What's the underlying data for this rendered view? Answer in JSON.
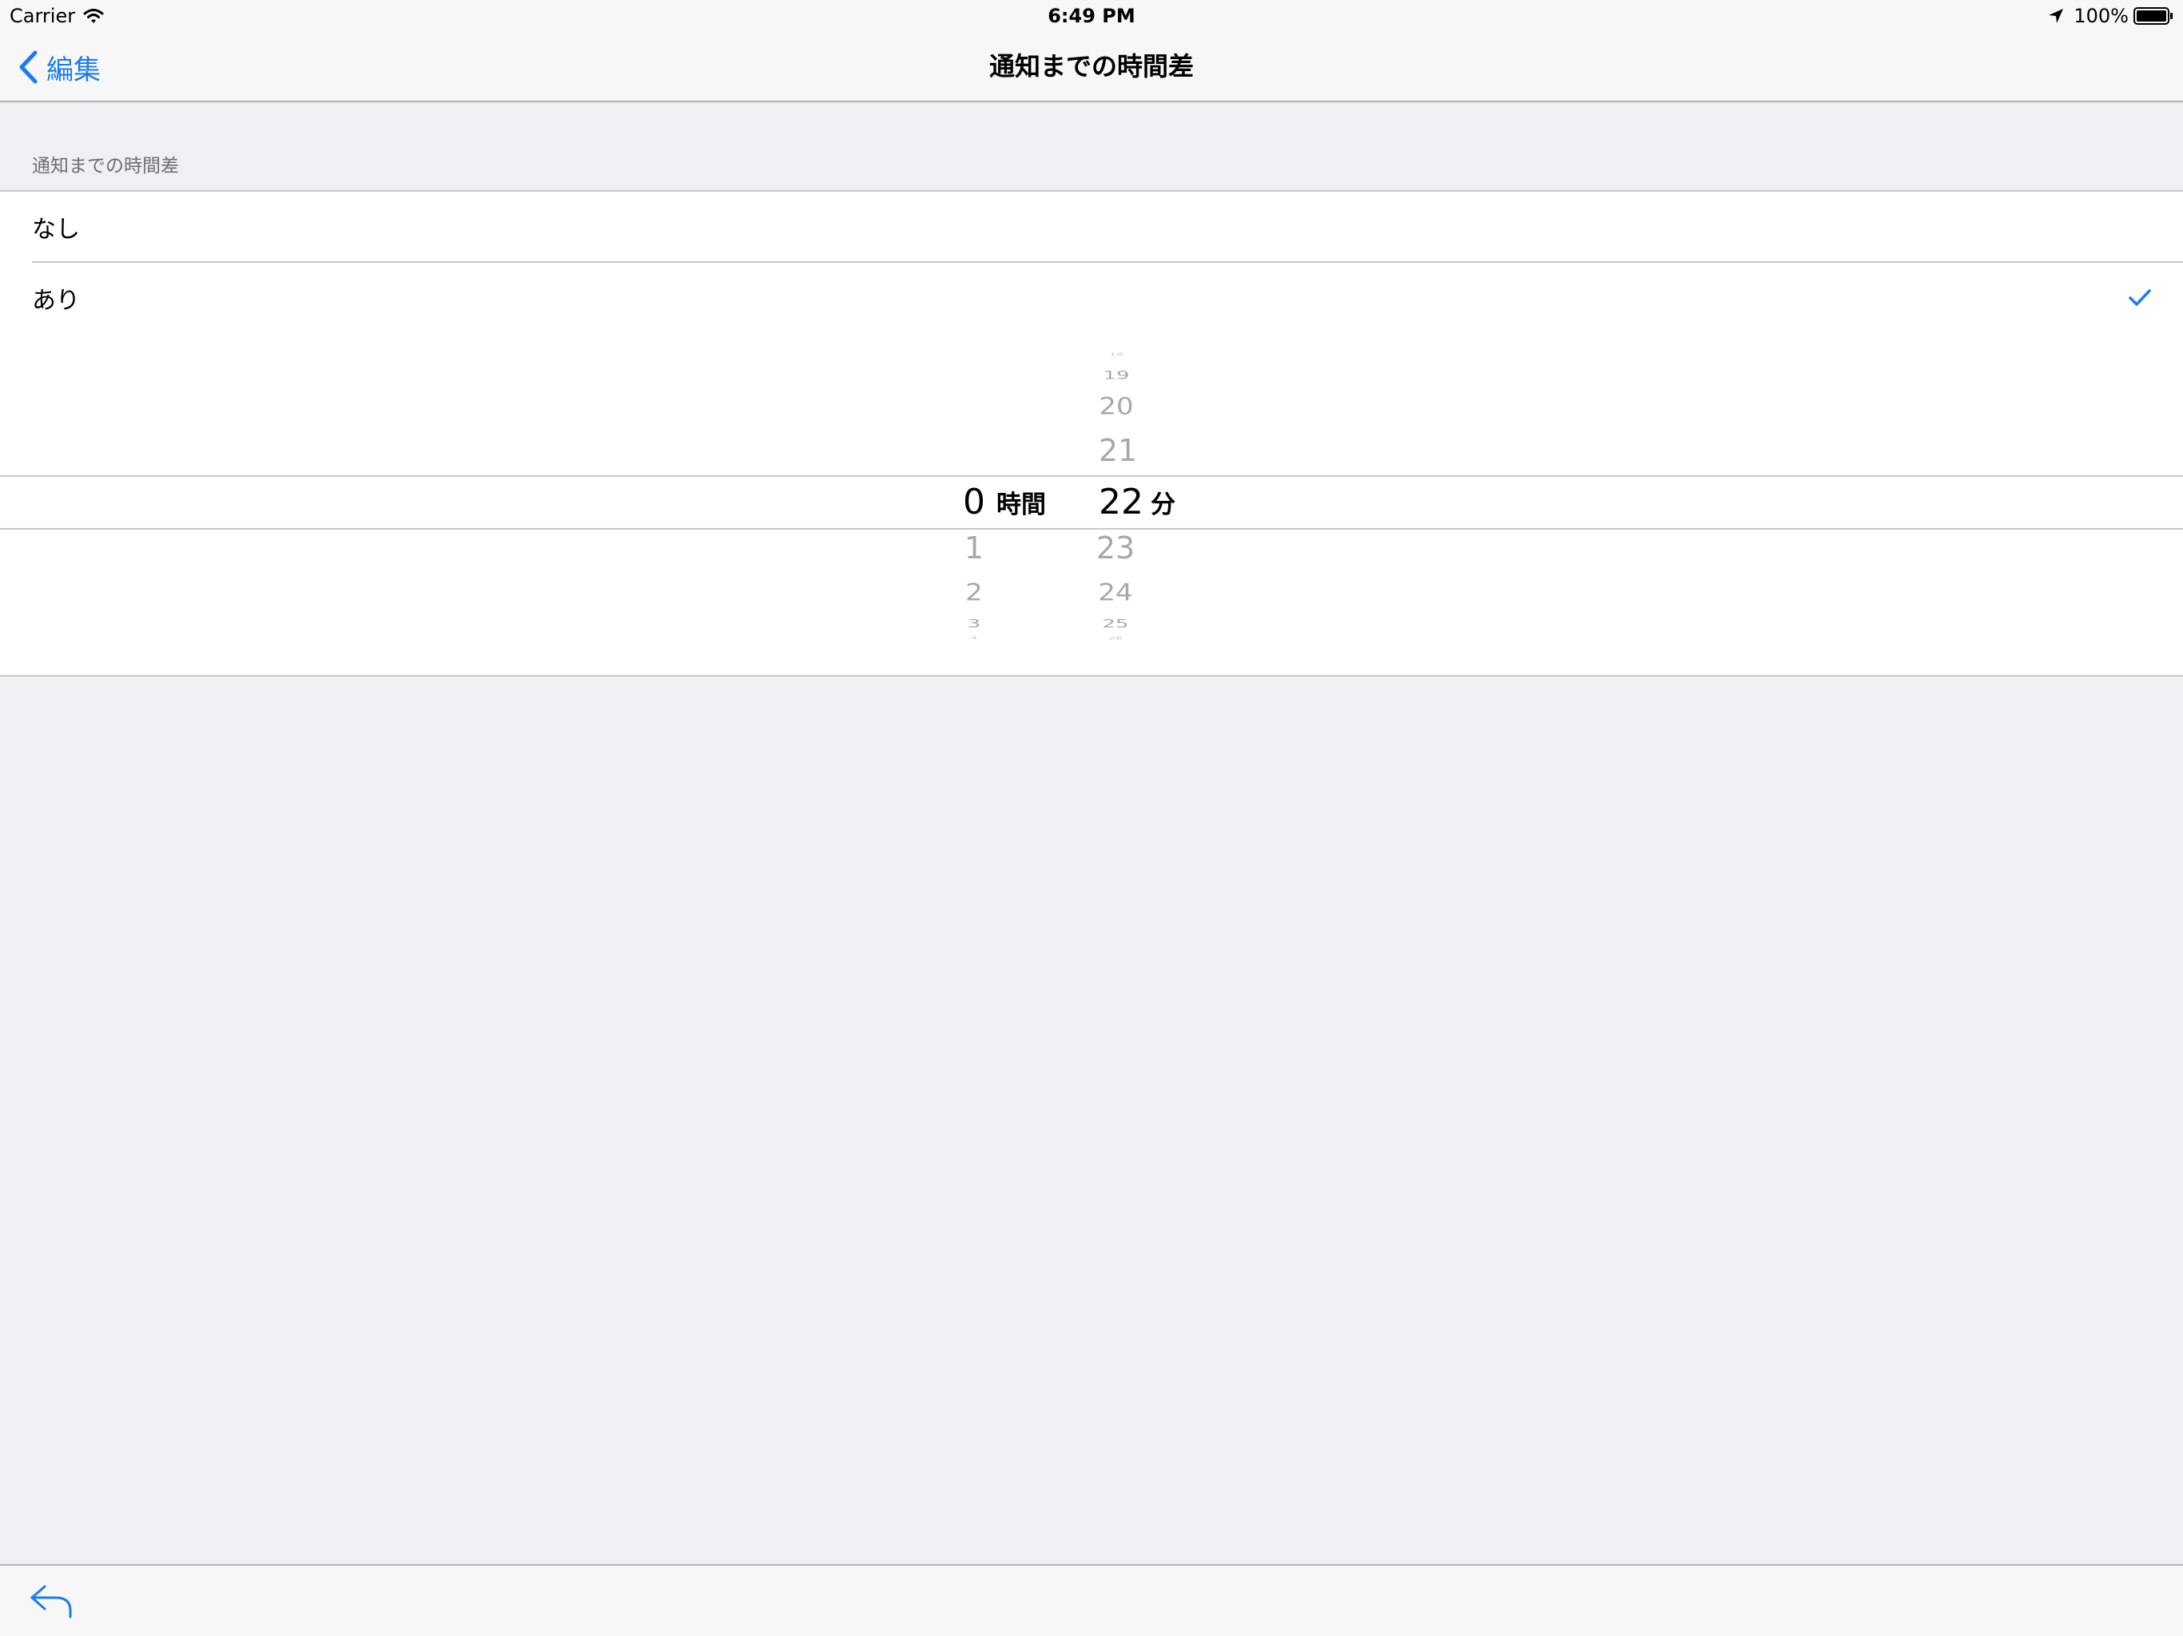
{
  "status_bar": {
    "carrier": "Carrier",
    "time": "6:49 PM",
    "battery": "100%",
    "icons": [
      "wifi-icon",
      "location-icon",
      "battery-icon"
    ]
  },
  "nav": {
    "back_label": "編集",
    "title": "通知までの時間差"
  },
  "section": {
    "header": "通知までの時間差"
  },
  "options": [
    {
      "label": "なし",
      "checked": false
    },
    {
      "label": "あり",
      "checked": true
    }
  ],
  "picker": {
    "hours": {
      "selected": "0",
      "unit": "時間",
      "below": [
        "1",
        "2",
        "3",
        "4"
      ]
    },
    "minutes": {
      "above": [
        "18",
        "19",
        "20",
        "21"
      ],
      "selected": "22",
      "unit": "分",
      "below": [
        "23",
        "24",
        "25",
        "26"
      ]
    }
  },
  "toolbar": {
    "icons": [
      "reply-icon"
    ]
  },
  "colors": {
    "accent": "#1A7CF5",
    "background": "#EFEFF4",
    "separator": "#C8C7CC",
    "picker_dim": "#A8A8A8"
  }
}
